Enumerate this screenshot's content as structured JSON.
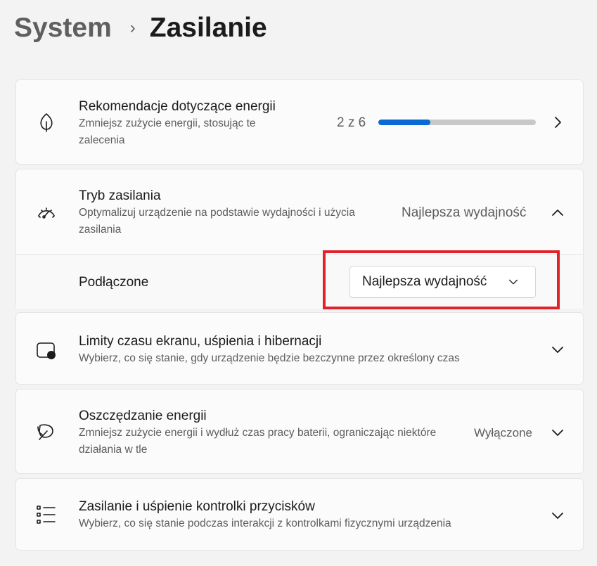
{
  "breadcrumb": {
    "parent": "System",
    "separator": "›",
    "current": "Zasilanie"
  },
  "recommendations": {
    "title": "Rekomendacje dotyczące energii",
    "description": "Zmniejsz zużycie energii, stosując te zalecenia",
    "count_text": "2 z 6",
    "progress": 0.33,
    "icon": "leaf-icon"
  },
  "power_mode": {
    "title": "Tryb zasilania",
    "description": "Optymalizuj urządzenie na podstawie wydajności i użycia zasilania",
    "current_value": "Najlepsza wydajność",
    "icon": "speedometer-icon",
    "plugged_in": {
      "label": "Podłączone",
      "selected": "Najlepsza wydajność"
    }
  },
  "screen_sleep": {
    "title": "Limity czasu ekranu, uśpienia i hibernacji",
    "description": "Wybierz, co się stanie, gdy urządzenie będzie bezczynne przez określony czas",
    "icon": "screen-sleep-icon"
  },
  "energy_saver": {
    "title": "Oszczędzanie energii",
    "description": "Zmniejsz zużycie energii i wydłuż czas pracy baterii, ograniczając niektóre działania w tle",
    "status": "Wyłączone",
    "icon": "energy-saver-leaf-icon"
  },
  "button_controls": {
    "title": "Zasilanie i uśpienie kontrolki przycisków",
    "description": "Wybierz, co się stanie podczas interakcji z kontrolkami fizycznymi urządzenia",
    "icon": "list-icon"
  },
  "colors": {
    "accent": "#0a6ad4",
    "highlight": "#e0232a"
  }
}
